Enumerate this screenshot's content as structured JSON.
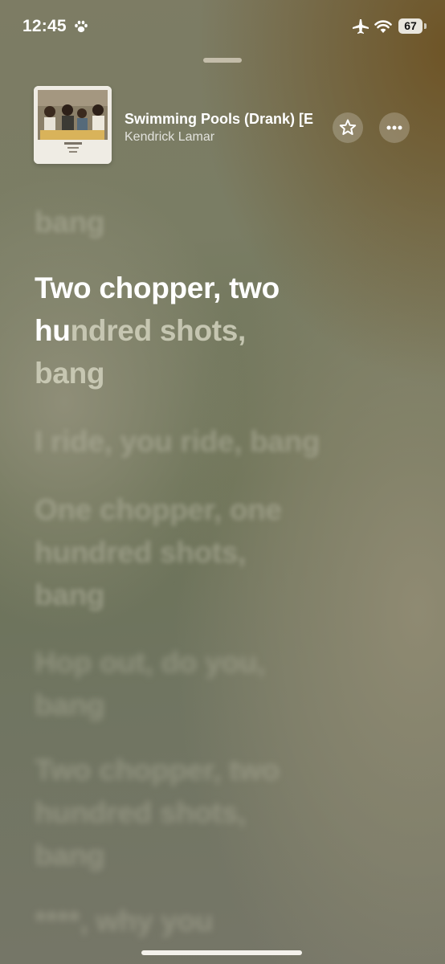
{
  "status_bar": {
    "time": "12:45",
    "battery": "67",
    "icons": [
      "paw-icon",
      "airplane-icon",
      "wifi-icon",
      "battery-icon"
    ]
  },
  "now_playing": {
    "title": "Swimming Pools (Drank) [E",
    "artist": "Kendrick Lamar",
    "favorite_icon": "star-icon",
    "more_icon": "ellipsis-icon"
  },
  "lyrics": {
    "previous": "bang",
    "current": {
      "line1": "Two chopper, two",
      "line2_sung": "hu",
      "line2_rest": "ndred shots,",
      "line3": "bang"
    },
    "upcoming": [
      "I ride, you ride, bang",
      "One chopper, one",
      "hundred shots,",
      "bang",
      "Hop out, do you,",
      "bang",
      "Two chopper, two",
      "hundred shots,",
      "bang",
      "****, why you"
    ]
  },
  "colors": {
    "active_lyric": "#ffffff",
    "background_top": "#6e5426",
    "background_mid": "#6b7256"
  }
}
